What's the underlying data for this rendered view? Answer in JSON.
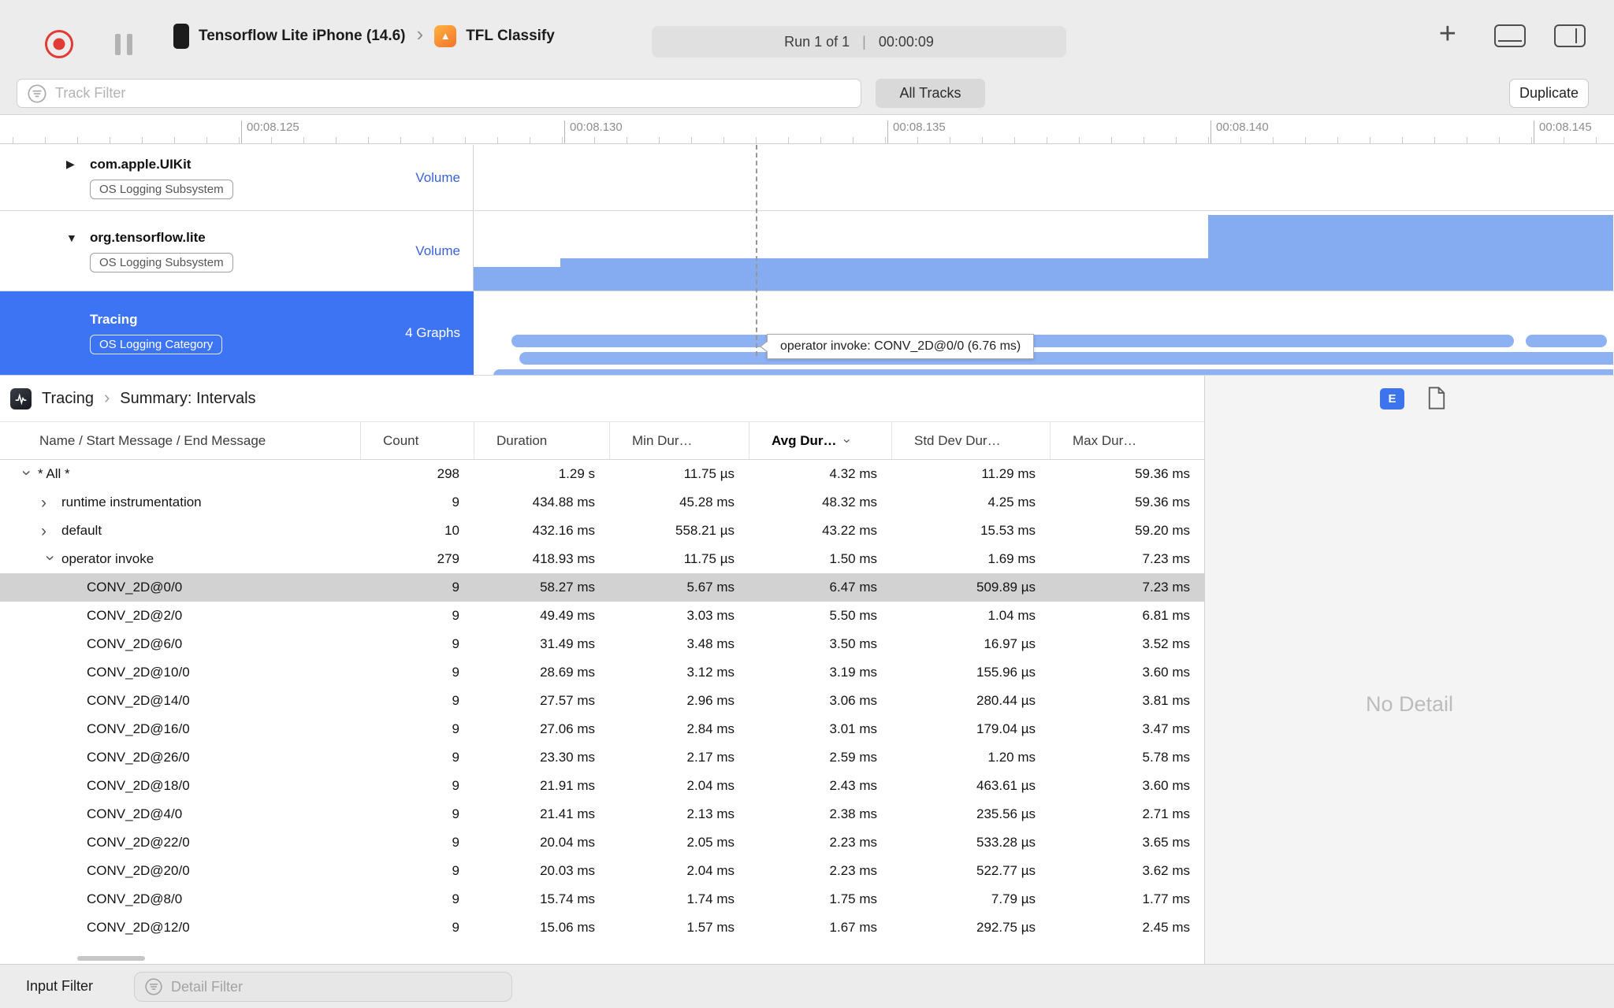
{
  "icons": {
    "add": "+",
    "chevron": "›",
    "disclosure_collapsed": "▶",
    "disclosure_expanded": "▼",
    "app_glyph": "▲"
  },
  "colors": {
    "selection_blue": "#3c74f3",
    "volume_bar_blue": "#85abf1",
    "capsule_blue": "#8eb1f3",
    "record_red": "#e23b36"
  },
  "toolbar": {
    "device": "Tensorflow Lite iPhone (14.6)",
    "app": "TFL Classify",
    "run_label": "Run 1 of 1",
    "run_separator": "|",
    "run_time": "00:00:09"
  },
  "filter_bar": {
    "track_filter_placeholder": "Track Filter",
    "all_tracks": "All Tracks",
    "duplicate": "Duplicate"
  },
  "ruler": {
    "ticks": [
      "00:08.125",
      "00:08.130",
      "00:08.135",
      "00:08.140",
      "00:08.145"
    ]
  },
  "tracks": [
    {
      "name": "com.apple.UIKit",
      "badge": "OS Logging Subsystem",
      "meta": "Volume"
    },
    {
      "name": "org.tensorflow.lite",
      "badge": "OS Logging Subsystem",
      "meta": "Volume"
    },
    {
      "name": "Tracing",
      "badge": "OS Logging Category",
      "meta": "4 Graphs"
    }
  ],
  "timeline": {
    "tooltip": "operator invoke: CONV_2D@0/0 (6.76 ms)"
  },
  "summary": {
    "breadcrumb": {
      "root": "Tracing",
      "page": "Summary: Intervals"
    },
    "columns": [
      "Name / Start Message / End Message",
      "Count",
      "Duration",
      "Min Dur…",
      "Avg Dur…",
      "Std Dev Dur…",
      "Max Dur…"
    ],
    "rows": [
      {
        "level": 0,
        "disclosure": "down",
        "selected": false,
        "name": "* All *",
        "cells": [
          "298",
          "1.29 s",
          "11.75 µs",
          "4.32 ms",
          "11.29 ms",
          "59.36 ms"
        ]
      },
      {
        "level": 1,
        "disclosure": "right",
        "selected": false,
        "name": "runtime instrumentation",
        "cells": [
          "9",
          "434.88 ms",
          "45.28 ms",
          "48.32 ms",
          "4.25 ms",
          "59.36 ms"
        ]
      },
      {
        "level": 1,
        "disclosure": "right",
        "selected": false,
        "name": "default",
        "cells": [
          "10",
          "432.16 ms",
          "558.21 µs",
          "43.22 ms",
          "15.53 ms",
          "59.20 ms"
        ]
      },
      {
        "level": 1,
        "disclosure": "down",
        "selected": false,
        "name": "operator invoke",
        "cells": [
          "279",
          "418.93 ms",
          "11.75 µs",
          "1.50 ms",
          "1.69 ms",
          "7.23 ms"
        ]
      },
      {
        "level": 2,
        "disclosure": "none",
        "selected": true,
        "name": "CONV_2D@0/0",
        "cells": [
          "9",
          "58.27 ms",
          "5.67 ms",
          "6.47 ms",
          "509.89 µs",
          "7.23 ms"
        ]
      },
      {
        "level": 2,
        "disclosure": "none",
        "selected": false,
        "name": "CONV_2D@2/0",
        "cells": [
          "9",
          "49.49 ms",
          "3.03 ms",
          "5.50 ms",
          "1.04 ms",
          "6.81 ms"
        ]
      },
      {
        "level": 2,
        "disclosure": "none",
        "selected": false,
        "name": "CONV_2D@6/0",
        "cells": [
          "9",
          "31.49 ms",
          "3.48 ms",
          "3.50 ms",
          "16.97 µs",
          "3.52 ms"
        ]
      },
      {
        "level": 2,
        "disclosure": "none",
        "selected": false,
        "name": "CONV_2D@10/0",
        "cells": [
          "9",
          "28.69 ms",
          "3.12 ms",
          "3.19 ms",
          "155.96 µs",
          "3.60 ms"
        ]
      },
      {
        "level": 2,
        "disclosure": "none",
        "selected": false,
        "name": "CONV_2D@14/0",
        "cells": [
          "9",
          "27.57 ms",
          "2.96 ms",
          "3.06 ms",
          "280.44 µs",
          "3.81 ms"
        ]
      },
      {
        "level": 2,
        "disclosure": "none",
        "selected": false,
        "name": "CONV_2D@16/0",
        "cells": [
          "9",
          "27.06 ms",
          "2.84 ms",
          "3.01 ms",
          "179.04 µs",
          "3.47 ms"
        ]
      },
      {
        "level": 2,
        "disclosure": "none",
        "selected": false,
        "name": "CONV_2D@26/0",
        "cells": [
          "9",
          "23.30 ms",
          "2.17 ms",
          "2.59 ms",
          "1.20 ms",
          "5.78 ms"
        ]
      },
      {
        "level": 2,
        "disclosure": "none",
        "selected": false,
        "name": "CONV_2D@18/0",
        "cells": [
          "9",
          "21.91 ms",
          "2.04 ms",
          "2.43 ms",
          "463.61 µs",
          "3.60 ms"
        ]
      },
      {
        "level": 2,
        "disclosure": "none",
        "selected": false,
        "name": "CONV_2D@4/0",
        "cells": [
          "9",
          "21.41 ms",
          "2.13 ms",
          "2.38 ms",
          "235.56 µs",
          "2.71 ms"
        ]
      },
      {
        "level": 2,
        "disclosure": "none",
        "selected": false,
        "name": "CONV_2D@22/0",
        "cells": [
          "9",
          "20.04 ms",
          "2.05 ms",
          "2.23 ms",
          "533.28 µs",
          "3.65 ms"
        ]
      },
      {
        "level": 2,
        "disclosure": "none",
        "selected": false,
        "name": "CONV_2D@20/0",
        "cells": [
          "9",
          "20.03 ms",
          "2.04 ms",
          "2.23 ms",
          "522.77 µs",
          "3.62 ms"
        ]
      },
      {
        "level": 2,
        "disclosure": "none",
        "selected": false,
        "name": "CONV_2D@8/0",
        "cells": [
          "9",
          "15.74 ms",
          "1.74 ms",
          "1.75 ms",
          "7.79 µs",
          "1.77 ms"
        ]
      },
      {
        "level": 2,
        "disclosure": "none",
        "selected": false,
        "name": "CONV_2D@12/0",
        "cells": [
          "9",
          "15.06 ms",
          "1.57 ms",
          "1.67 ms",
          "292.75 µs",
          "2.45 ms"
        ]
      }
    ]
  },
  "detail_pane": {
    "e_button": "E",
    "no_detail": "No Detail"
  },
  "bottom_bar": {
    "input_filter_label": "Input Filter",
    "detail_filter_placeholder": "Detail Filter"
  }
}
